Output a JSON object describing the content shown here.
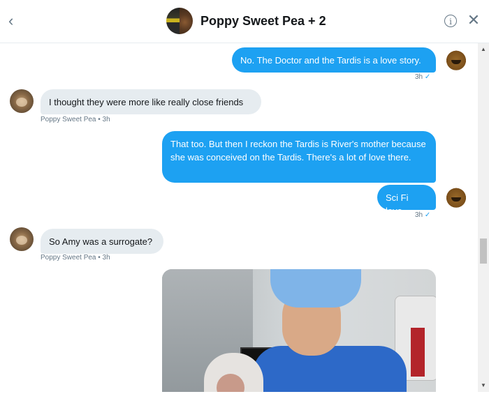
{
  "header": {
    "title": "Poppy Sweet Pea + 2",
    "back_icon": "‹",
    "info_icon": "i",
    "close_icon": "✕"
  },
  "messages": [
    {
      "direction": "out",
      "text": "No. The Doctor and the Tardis is a love story.",
      "meta": "3h",
      "status": "✓"
    },
    {
      "direction": "in",
      "text": "I thought they were more like really close friends",
      "meta": "Poppy Sweet Pea • 3h"
    },
    {
      "direction": "out",
      "text": "That too. But then I reckon the Tardis is River's mother because she was conceived on the Tardis. There's a lot of love there."
    },
    {
      "direction": "out",
      "text": "Sci Fi love.",
      "meta": "3h",
      "status": "✓"
    },
    {
      "direction": "in",
      "text": "So Amy was a surrogate?",
      "meta": "Poppy Sweet Pea • 3h"
    }
  ],
  "scrollbar": {
    "up": "▲",
    "down": "▼"
  }
}
